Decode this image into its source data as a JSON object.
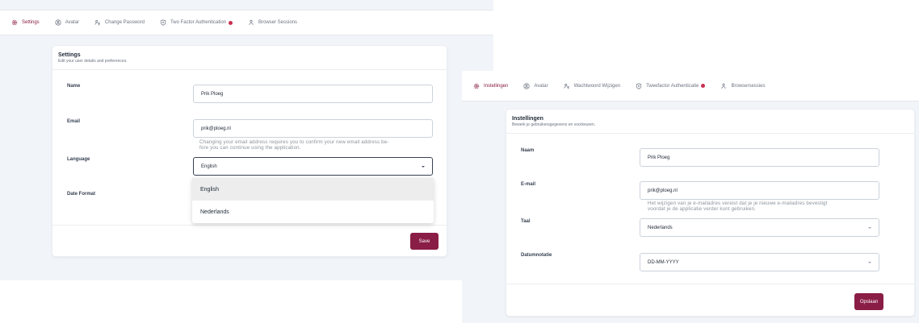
{
  "colors": {
    "accent": "#8a1d45",
    "notification_dot": "#c8304f",
    "page_bg": "#f1f4f8"
  },
  "en": {
    "tabs": [
      {
        "label": "Settings",
        "icon": "gear-icon",
        "active": true
      },
      {
        "label": "Avatar",
        "icon": "user-circle-icon",
        "active": false
      },
      {
        "label": "Change Password",
        "icon": "user-key-icon",
        "active": false
      },
      {
        "label": "Two Factor Authentication",
        "icon": "shield-icon",
        "active": false,
        "badge": true
      },
      {
        "label": "Browser Sessions",
        "icon": "users-icon",
        "active": false
      }
    ],
    "card": {
      "title": "Settings",
      "subtitle": "Edit your user details and preferences."
    },
    "fields": {
      "name": {
        "label": "Name",
        "value": "Prik Ploeg"
      },
      "email": {
        "label": "Email",
        "value": "prik@ploeg.nl",
        "help_line1": "Changing your email address requires you to confirm your new email address be-",
        "help_line2": "fore you can continue using the application."
      },
      "language": {
        "label": "Language",
        "value": "English",
        "options": [
          "English",
          "Nederlands"
        ],
        "highlighted": "English"
      },
      "date_format": {
        "label": "Date Format"
      }
    },
    "save_label": "Save"
  },
  "nl": {
    "tabs": [
      {
        "label": "Instellingen",
        "icon": "gear-icon",
        "active": true
      },
      {
        "label": "Avatar",
        "icon": "user-circle-icon",
        "active": false
      },
      {
        "label": "Wachtwoord Wijzigen",
        "icon": "user-key-icon",
        "active": false
      },
      {
        "label": "Tweefactor Authenticatie",
        "icon": "shield-icon",
        "active": false,
        "badge": true
      },
      {
        "label": "Browsersessies",
        "icon": "users-icon",
        "active": false
      }
    ],
    "card": {
      "title": "Instellingen",
      "subtitle": "Bewerk je gebruikersgegevens en voorkeuren."
    },
    "fields": {
      "name": {
        "label": "Naam",
        "value": "Prik Ploeg"
      },
      "email": {
        "label": "E-mail",
        "value": "prik@ploeg.nl",
        "help_line1": "Het wijzigen van je e-mailadres vereist dat je je nieuwe e-mailadres bevestigt",
        "help_line2": "voordat je de applicatie verder kunt gebruiken."
      },
      "language": {
        "label": "Taal",
        "value": "Nederlands"
      },
      "date_format": {
        "label": "Datumnotatie",
        "value": "DD-MM-YYYY"
      }
    },
    "save_label": "Opslaan"
  }
}
